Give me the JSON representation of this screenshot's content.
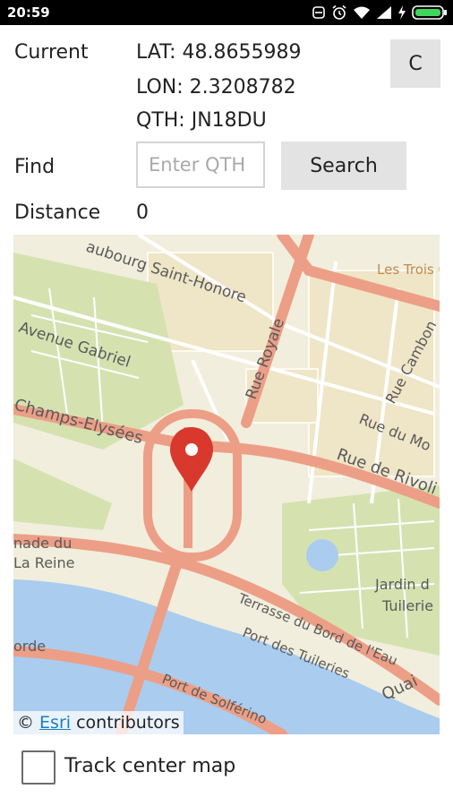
{
  "status_bar": {
    "time": "20:59",
    "icons": [
      "notification-off-icon",
      "alarm-icon",
      "wifi-icon",
      "cell-signal-icon",
      "charging-icon",
      "battery-icon"
    ]
  },
  "location": {
    "current_label": "Current",
    "lat": "LAT: 48.8655989",
    "lon": "LON: 2.3208782",
    "qth": "QTH: JN18DU",
    "clear_button_label": "C"
  },
  "find": {
    "label": "Find",
    "input_value": "",
    "input_placeholder": "Enter QTH",
    "search_button_label": "Search"
  },
  "distance": {
    "label": "Distance",
    "value": "0"
  },
  "map": {
    "labels": {
      "faubourg": "aubourg Saint-Honore",
      "trois_quartiers": "Les Trois Quartiers",
      "avenue_gabriel": "Avenue Gabriel",
      "rue_royale": "Rue Royale",
      "rue_cambon": "Rue Cambon",
      "rue_du_mont": "Rue du Mo",
      "champs": "Champs-Elysées",
      "rue_de_rivoli": "Rue de Rivoli",
      "cours_reine_1": "nade du",
      "cours_reine_2": "La Reine",
      "jardin_1": "Jardin d",
      "jardin_2": "Tuilerie",
      "terrasse": "Terrasse du Bord de l'Eau",
      "port_tuileries": "Port des Tuileries",
      "quai": "Quai",
      "orde": "orde",
      "port_solferino": "Port de Solférino"
    },
    "attribution": {
      "prefix": "©",
      "link": "Esri",
      "suffix": "contributors"
    }
  },
  "track": {
    "label": "Track center map",
    "checked": false
  },
  "colors": {
    "major_road": "#ec9f86",
    "road_casing": "#d9866c",
    "water": "#aaccee",
    "park": "#d5e2b0",
    "marker": "#d9382c"
  }
}
